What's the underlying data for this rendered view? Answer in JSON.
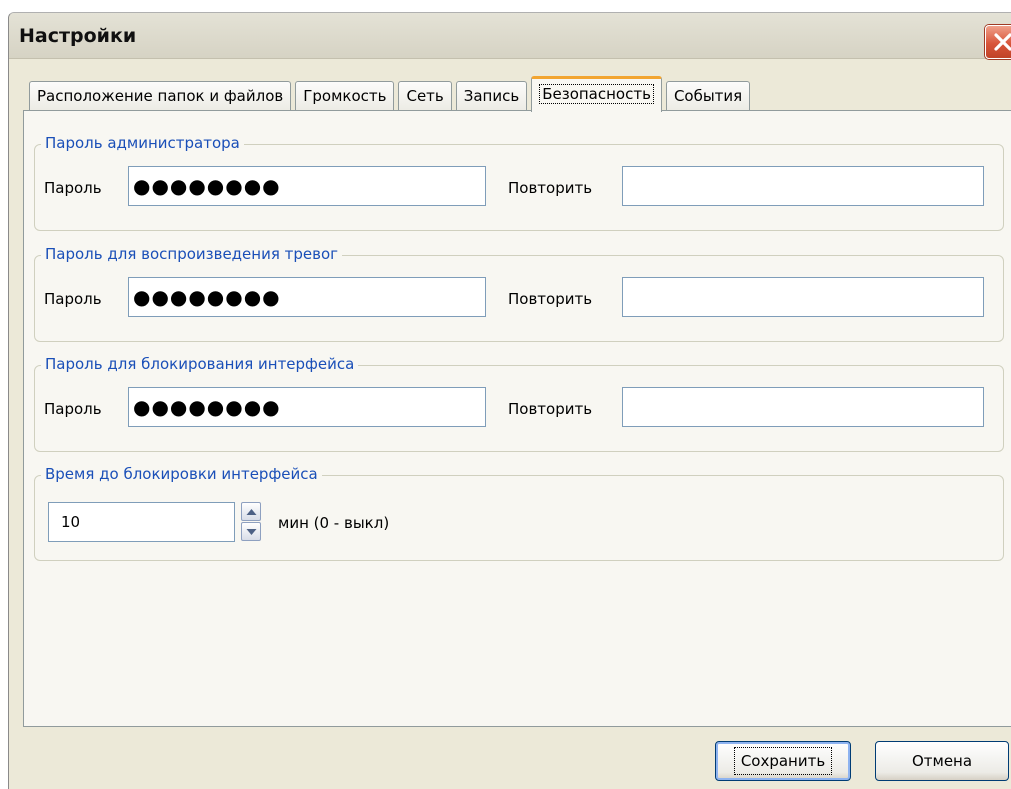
{
  "window": {
    "title": "Настройки"
  },
  "tabs": [
    {
      "label": "Расположение папок и файлов"
    },
    {
      "label": "Громкость"
    },
    {
      "label": "Сеть"
    },
    {
      "label": "Запись"
    },
    {
      "label": "Безопасность"
    },
    {
      "label": "События"
    }
  ],
  "active_tab": "Безопасность",
  "groups": {
    "admin": {
      "title": "Пароль администратора",
      "password_label": "Пароль",
      "password_value": "●●●●●●●●",
      "repeat_label": "Повторить",
      "repeat_value": ""
    },
    "alarms": {
      "title": "Пароль для воспроизведения тревог",
      "password_label": "Пароль",
      "password_value": "●●●●●●●●",
      "repeat_label": "Повторить",
      "repeat_value": ""
    },
    "interface": {
      "title": "Пароль для блокирования интерфейса",
      "password_label": "Пароль",
      "password_value": "●●●●●●●●",
      "repeat_label": "Повторить",
      "repeat_value": ""
    },
    "lock_time": {
      "title": "Время до блокировки интерфейса",
      "value": "10",
      "unit_label": "мин (0 - выкл)"
    }
  },
  "buttons": {
    "save": "Сохранить",
    "cancel": "Отмена"
  },
  "colors": {
    "group_title": "#1a4fb8",
    "active_tab_accent": "#f2a531",
    "close_button": "#d8553a"
  },
  "icons": {
    "close": "close-icon",
    "spin_up": "chevron-up-icon",
    "spin_down": "chevron-down-icon"
  }
}
